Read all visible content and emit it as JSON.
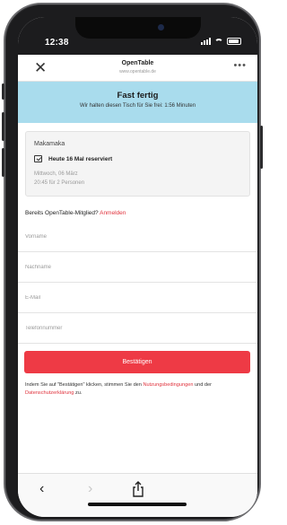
{
  "status_bar": {
    "time": "12:38"
  },
  "nav": {
    "title": "OpenTable",
    "url": "www.opentable.de",
    "close_icon": "close-icon",
    "more_icon": "more-icon"
  },
  "banner": {
    "title": "Fast fertig",
    "subtitle": "Wir halten diesen Tisch für Sie frei: 1:56 Minuten",
    "color": "#a9dced"
  },
  "reservation": {
    "restaurant": "Makamaka",
    "status": "Heute 16 Mal reserviert",
    "date": "Mittwoch, 06 März",
    "party": "20:45 für 2 Personen"
  },
  "member": {
    "question": "Bereits OpenTable-Mitglied?",
    "login_link": "Anmelden"
  },
  "form": {
    "first_name_placeholder": "Vorname",
    "last_name_placeholder": "Nachname",
    "email_placeholder": "E-Mail",
    "phone_placeholder": "Telefonnummer"
  },
  "confirm_button": {
    "label": "Bestätigen",
    "color": "#ee3a45"
  },
  "terms": {
    "prefix": "Indem Sie auf \"Bestätigen\" klicken, stimmen Sie den",
    "terms_link": "Nutzungsbedingungen",
    "middle": " und der ",
    "privacy_link": "Datenschutzerklärung",
    "suffix": " zu."
  },
  "toolbar": {
    "back_icon": "back-arrow-icon",
    "forward_icon": "forward-arrow-icon",
    "share_icon": "share-icon"
  }
}
